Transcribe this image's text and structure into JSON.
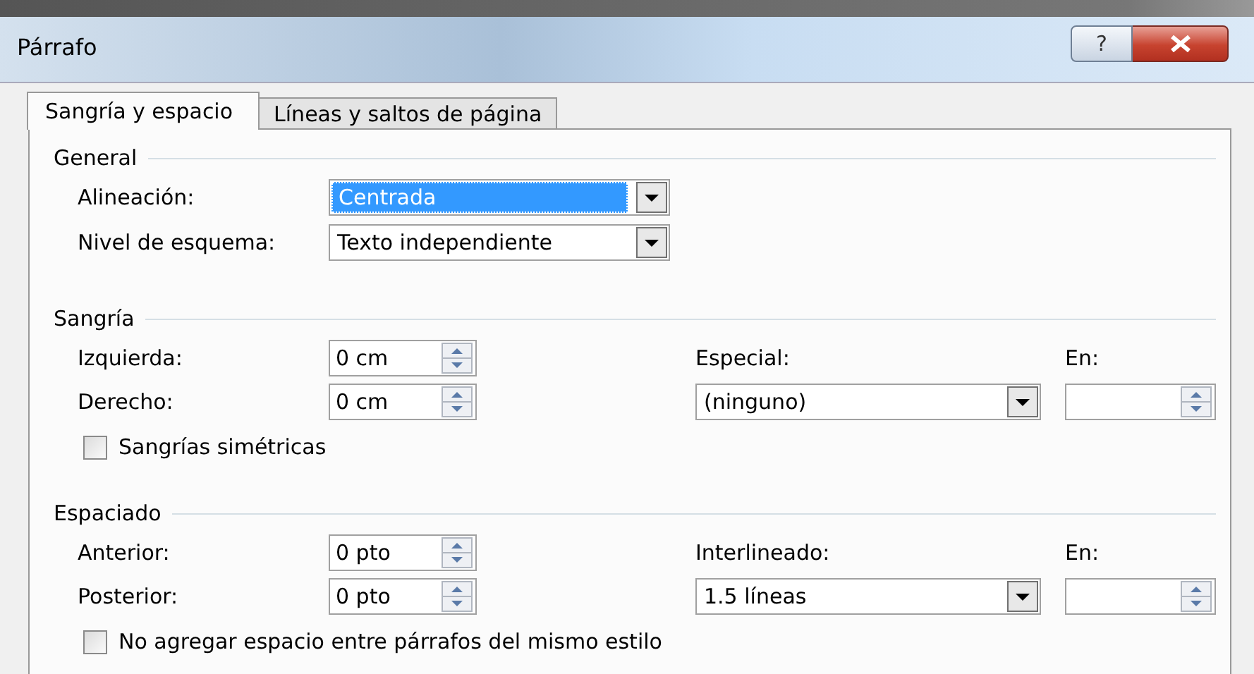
{
  "window": {
    "title": "Párrafo",
    "help": "?"
  },
  "tabs": [
    {
      "label": "Sangría y espacio",
      "selected": true
    },
    {
      "label": "Líneas y saltos de página",
      "selected": false
    }
  ],
  "general": {
    "heading": "General",
    "fields": [
      {
        "label": "Alineación:",
        "value": "Centrada",
        "selected": true
      },
      {
        "label": "Nivel de esquema:",
        "value": "Texto independiente",
        "selected": false
      }
    ]
  },
  "sangria": {
    "heading": "Sangría",
    "left": [
      {
        "label": "Izquierda:",
        "value": "0 cm"
      },
      {
        "label": "Derecho:",
        "value": "0 cm"
      }
    ],
    "special": {
      "label": "Especial:",
      "value": "(ninguno)"
    },
    "by": {
      "label": "En:"
    },
    "checkbox": {
      "label": "Sangrías simétricas",
      "checked": false
    }
  },
  "espaciado": {
    "heading": "Espaciado",
    "left": [
      {
        "label": "Anterior:",
        "value": "0 pto"
      },
      {
        "label": "Posterior:",
        "value": "0 pto"
      }
    ],
    "special": {
      "label": "Interlineado:",
      "value": "1.5 líneas"
    },
    "by": {
      "label": "En:"
    },
    "checkbox": {
      "label": "No agregar espacio entre párrafos del mismo estilo",
      "checked": false
    }
  }
}
